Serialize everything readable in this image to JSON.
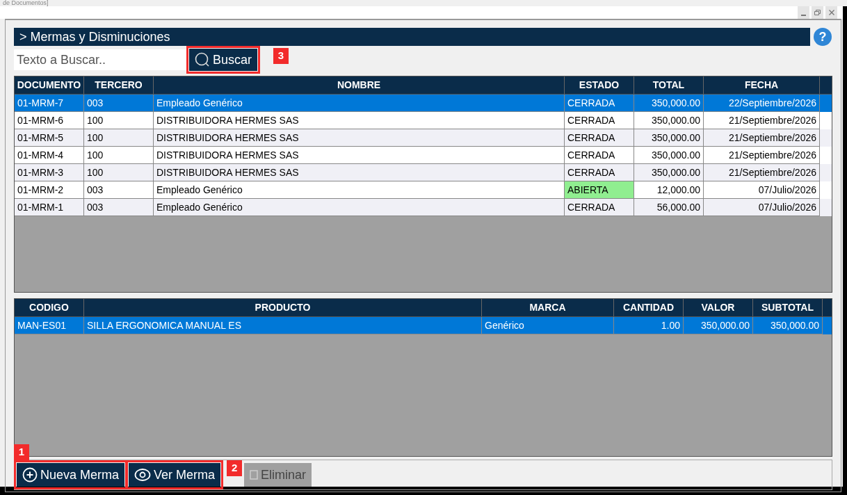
{
  "window": {
    "title": "de Documentos]"
  },
  "panel_title": "> Mermas y Disminuciones",
  "help": "?",
  "search": {
    "placeholder": "Texto a Buscar..",
    "button": "Buscar",
    "callout": "3"
  },
  "documents": {
    "columns": [
      "DOCUMENTO",
      "TERCERO",
      "NOMBRE",
      "ESTADO",
      "TOTAL",
      "FECHA"
    ],
    "rows": [
      {
        "selected": true,
        "cells": [
          "01-MRM-7",
          "003",
          "Empleado Genérico",
          "CERRADA",
          "350,000.00",
          "22/Septiembre/2026"
        ]
      },
      {
        "selected": false,
        "cells": [
          "01-MRM-6",
          "100",
          "DISTRIBUIDORA HERMES SAS",
          "CERRADA",
          "350,000.00",
          "21/Septiembre/2026"
        ]
      },
      {
        "selected": false,
        "cells": [
          "01-MRM-5",
          "100",
          "DISTRIBUIDORA HERMES SAS",
          "CERRADA",
          "350,000.00",
          "21/Septiembre/2026"
        ]
      },
      {
        "selected": false,
        "cells": [
          "01-MRM-4",
          "100",
          "DISTRIBUIDORA HERMES SAS",
          "CERRADA",
          "350,000.00",
          "21/Septiembre/2026"
        ]
      },
      {
        "selected": false,
        "cells": [
          "01-MRM-3",
          "100",
          "DISTRIBUIDORA HERMES SAS",
          "CERRADA",
          "350,000.00",
          "21/Septiembre/2026"
        ]
      },
      {
        "selected": false,
        "color": "#90ee90",
        "cells": [
          "01-MRM-2",
          "003",
          "Empleado Genérico",
          "ABIERTA",
          "12,000.00",
          "07/Julio/2026"
        ]
      },
      {
        "selected": false,
        "cells": [
          "01-MRM-1",
          "003",
          "Empleado Genérico",
          "CERRADA",
          "56,000.00",
          "07/Julio/2026"
        ]
      }
    ]
  },
  "details": {
    "columns": [
      "CODIGO",
      "PRODUCTO",
      "MARCA",
      "CANTIDAD",
      "VALOR",
      "SUBTOTAL"
    ],
    "rows": [
      {
        "selected": true,
        "cells": [
          "MAN-ES01",
          "SILLA ERGONOMICA MANUAL ES",
          "Genérico",
          "1.00",
          "350,000.00",
          "350,000.00"
        ]
      }
    ]
  },
  "buttons": [
    {
      "kind": "add",
      "label": "Nueva Merma",
      "disabled": false,
      "callout": "1"
    },
    {
      "kind": "view",
      "label": "Ver Merma",
      "disabled": false,
      "callout": "2"
    },
    {
      "kind": "delete",
      "label": "Eliminar",
      "disabled": true
    }
  ]
}
